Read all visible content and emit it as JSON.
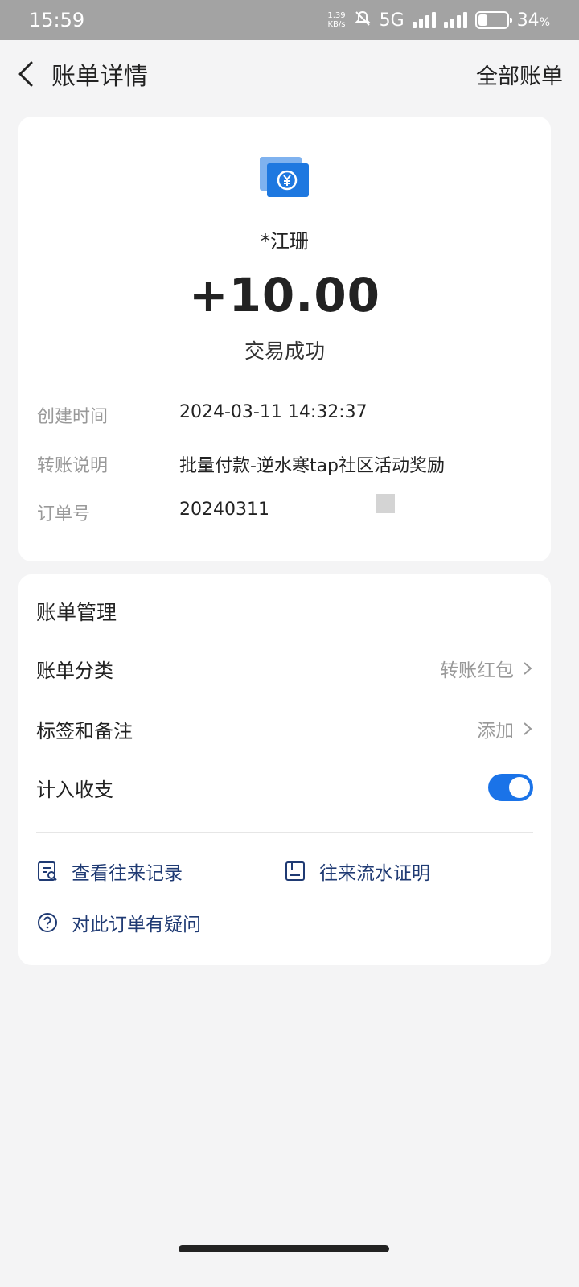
{
  "status_bar": {
    "time": "15:59",
    "speed_top": "1.39",
    "speed_bottom": "KB/s",
    "network": "5G",
    "battery": "34",
    "battery_unit": "%"
  },
  "nav": {
    "title": "账单详情",
    "right_label": "全部账单"
  },
  "transaction": {
    "payee": "*江珊",
    "amount": "+10.00",
    "status": "交易成功",
    "details": [
      {
        "label": "创建时间",
        "value": "2024-03-11 14:32:37"
      },
      {
        "label": "转账说明",
        "value": "批量付款-逆水寒tap社区活动奖励"
      },
      {
        "label": "订单号",
        "value": "20240311"
      }
    ]
  },
  "manage": {
    "title": "账单管理",
    "category_label": "账单分类",
    "category_value": "转账红包",
    "tag_label": "标签和备注",
    "tag_value": "添加",
    "count_label": "计入收支",
    "count_enabled": true,
    "links": {
      "records": "查看往来记录",
      "proof": "往来流水证明",
      "question": "对此订单有疑问"
    }
  },
  "colors": {
    "accent": "#1a73e8",
    "link": "#1f3a73",
    "background": "#f4f4f5"
  }
}
